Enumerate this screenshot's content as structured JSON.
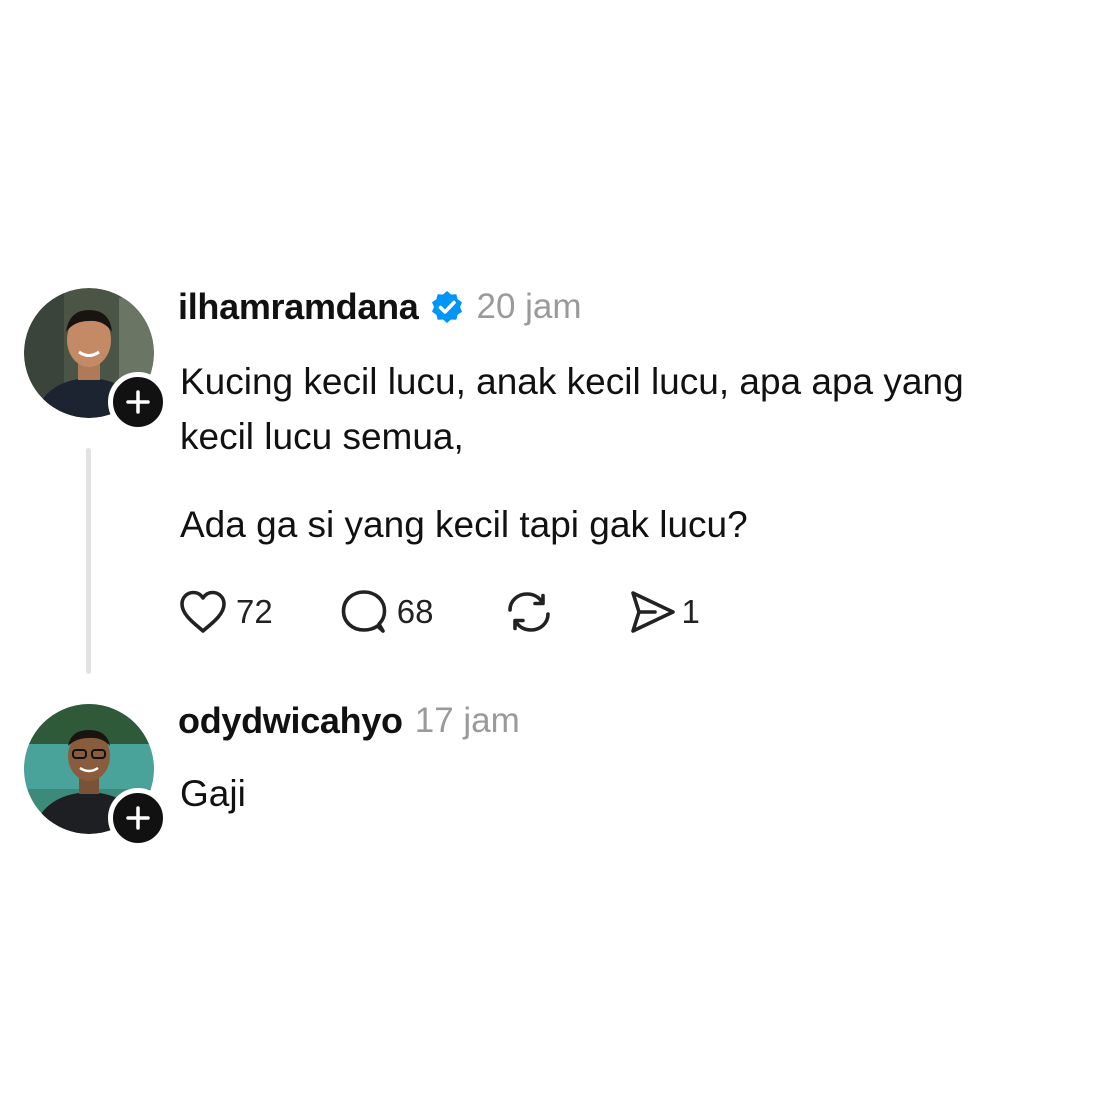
{
  "post": {
    "username": "ilhamramdana",
    "time": "20 jam",
    "line1": "Kucing kecil lucu, anak kecil lucu, apa apa yang",
    "line2": "kecil lucu semua,",
    "line3": "Ada ga si yang kecil tapi gak lucu?",
    "likes": "72",
    "replies": "68",
    "shares": "1",
    "verified": true
  },
  "reply": {
    "username": "odydwicahyo",
    "time": "17 jam",
    "text": "Gaji"
  },
  "icons": {
    "verified": "verified-badge-icon",
    "like": "heart-icon",
    "reply": "comment-bubble-icon",
    "repost": "repost-icon",
    "share": "send-icon",
    "follow": "plus-icon"
  },
  "colors": {
    "verified": "#0095f6",
    "text": "#111111",
    "muted": "#9a9a9a",
    "thread_line": "#e2e2e2"
  }
}
